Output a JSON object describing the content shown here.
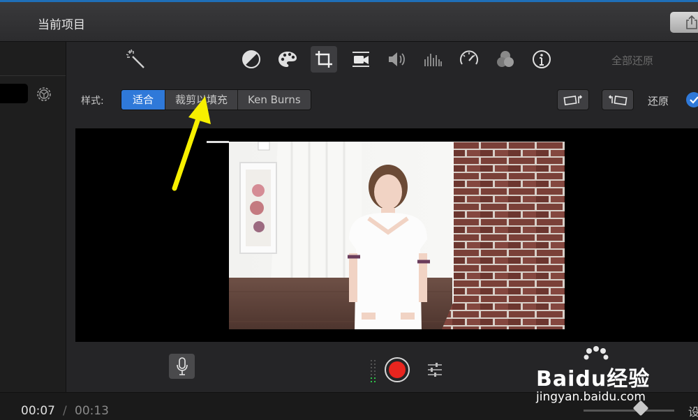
{
  "titlebar": {
    "title": "当前项目"
  },
  "toolbar": {
    "restore_all": "全部还原",
    "tools": [
      "magic-wand-icon",
      "color-balance-icon",
      "palette-icon",
      "crop-icon",
      "stabilization-icon",
      "volume-icon",
      "equalizer-icon",
      "speed-icon",
      "filter-icon",
      "info-icon"
    ],
    "active_tool": "crop-icon"
  },
  "crop": {
    "style_label": "样式:",
    "options": [
      "适合",
      "裁剪以填充",
      "Ken Burns"
    ],
    "selected": "适合",
    "reset_label": "还原"
  },
  "timebar": {
    "current": "00:07",
    "separator": "/",
    "total": "00:13",
    "settings_partial": "设"
  },
  "watermark": {
    "brand": "Baidu经验",
    "url": "jingyan.baidu.com"
  },
  "colors": {
    "accent": "#2f79d9",
    "record": "#e8251f",
    "arrow": "#f7f000"
  }
}
